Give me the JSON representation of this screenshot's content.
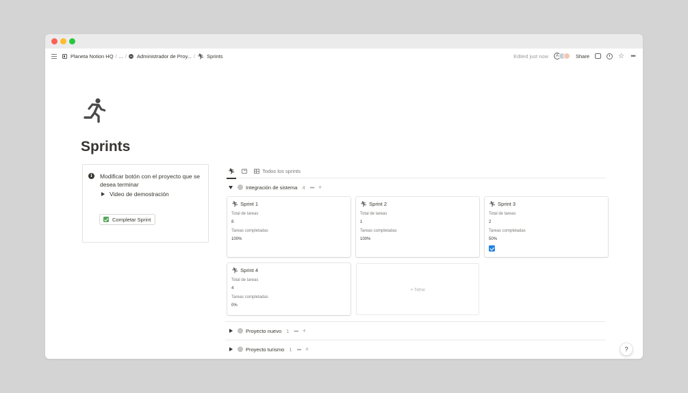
{
  "breadcrumb": {
    "items": [
      "Planeta Notion HQ",
      "...",
      "Administrador de Proy...",
      "Sprints"
    ],
    "separator": "/"
  },
  "topbar": {
    "edited": "Edited just now",
    "avatar_initial": "A",
    "share": "Share"
  },
  "page": {
    "icon": "runner-icon",
    "title": "Sprints"
  },
  "callout": {
    "text": "Modificar botón con el proyecto que se desea terminar",
    "toggle": "Video de demostración",
    "button": "Completar Sprint"
  },
  "database": {
    "views": [
      "",
      "",
      "Todos los sprints"
    ],
    "groups": [
      {
        "name": "Integración de sistema",
        "count": "4",
        "expanded": true,
        "cards": [
          {
            "title": "Sprint 1",
            "total_label": "Total de tareas",
            "total": "8",
            "done_label": "Tareas completadas",
            "done": "100%",
            "checked": false
          },
          {
            "title": "Sprint 2",
            "total_label": "Total de tareas",
            "total": "1",
            "done_label": "Tareas completadas",
            "done": "100%",
            "checked": false
          },
          {
            "title": "Sprint 3",
            "total_label": "Total de tareas",
            "total": "2",
            "done_label": "Tareas completadas",
            "done": "50%",
            "checked": true
          },
          {
            "title": "Sprint 4",
            "total_label": "Total de tareas",
            "total": "4",
            "done_label": "Tareas completadas",
            "done": "0%",
            "checked": false
          }
        ],
        "new_label": "+ New"
      },
      {
        "name": "Proyecto nuevo",
        "count": "1",
        "expanded": false
      },
      {
        "name": "Proyecto turismo",
        "count": "1",
        "expanded": false
      }
    ],
    "more": "•••",
    "plus": "+"
  },
  "help": "?",
  "colors": {
    "accent_blue": "#2383e2",
    "check_green": "#58a55c",
    "text": "#37352f"
  }
}
